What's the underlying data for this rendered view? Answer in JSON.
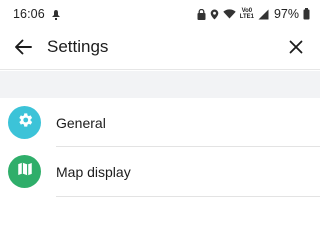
{
  "status_bar": {
    "time": "16:06",
    "network_label_top": "Vo0",
    "network_label_bottom": "LTE1",
    "battery": "97%"
  },
  "app_bar": {
    "title": "Settings",
    "back_icon": "arrow-left-icon",
    "close_icon": "close-icon"
  },
  "settings_list": {
    "items": [
      {
        "label": "General",
        "icon": "gear-icon",
        "icon_bg": "#3cc3d8"
      },
      {
        "label": "Map display",
        "icon": "map-icon",
        "icon_bg": "#2fae6a"
      }
    ]
  },
  "colors": {
    "band": "#f2f3f5",
    "divider": "#e3e3e3",
    "text": "#1c1c1c"
  }
}
